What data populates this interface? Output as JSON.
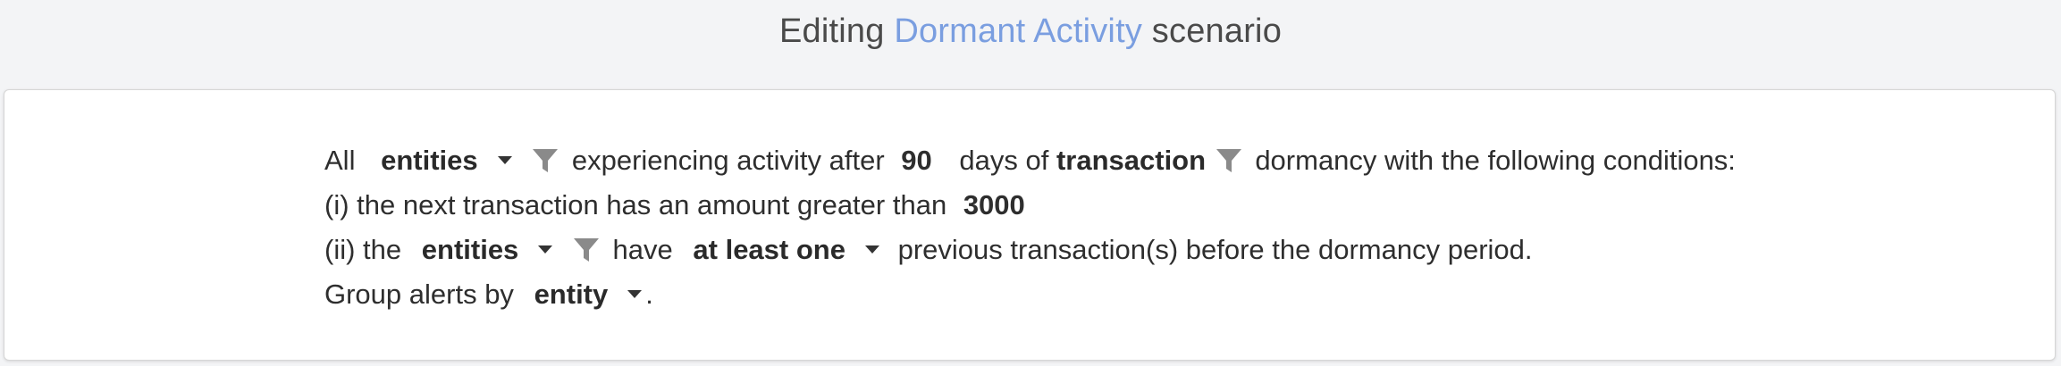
{
  "header": {
    "prefix": "Editing",
    "scenario_name": "Dormant Activity",
    "suffix": "scenario"
  },
  "sentence": {
    "line1": {
      "t1": "All",
      "entity_select": "entities",
      "t2": "experiencing activity after",
      "days_value": "90",
      "t3": "days of",
      "dormancy_type": "transaction",
      "t4": "dormancy with the following conditions:"
    },
    "line2": {
      "t1": "(i) the next transaction has an amount greater than",
      "amount_value": "3000"
    },
    "line3": {
      "t1": "(ii) the",
      "entity_select": "entities",
      "t2": "have",
      "quantity_select": "at least one",
      "t3": "previous transaction(s) before the dormancy period."
    },
    "line4": {
      "t1": "Group alerts by",
      "group_select": "entity",
      "t2": "."
    }
  },
  "icons": {
    "filter": "funnel-icon",
    "dropdown": "caret-down-icon"
  },
  "colors": {
    "link": "#7a9ee0",
    "filter_icon": "#8a8a8a"
  }
}
